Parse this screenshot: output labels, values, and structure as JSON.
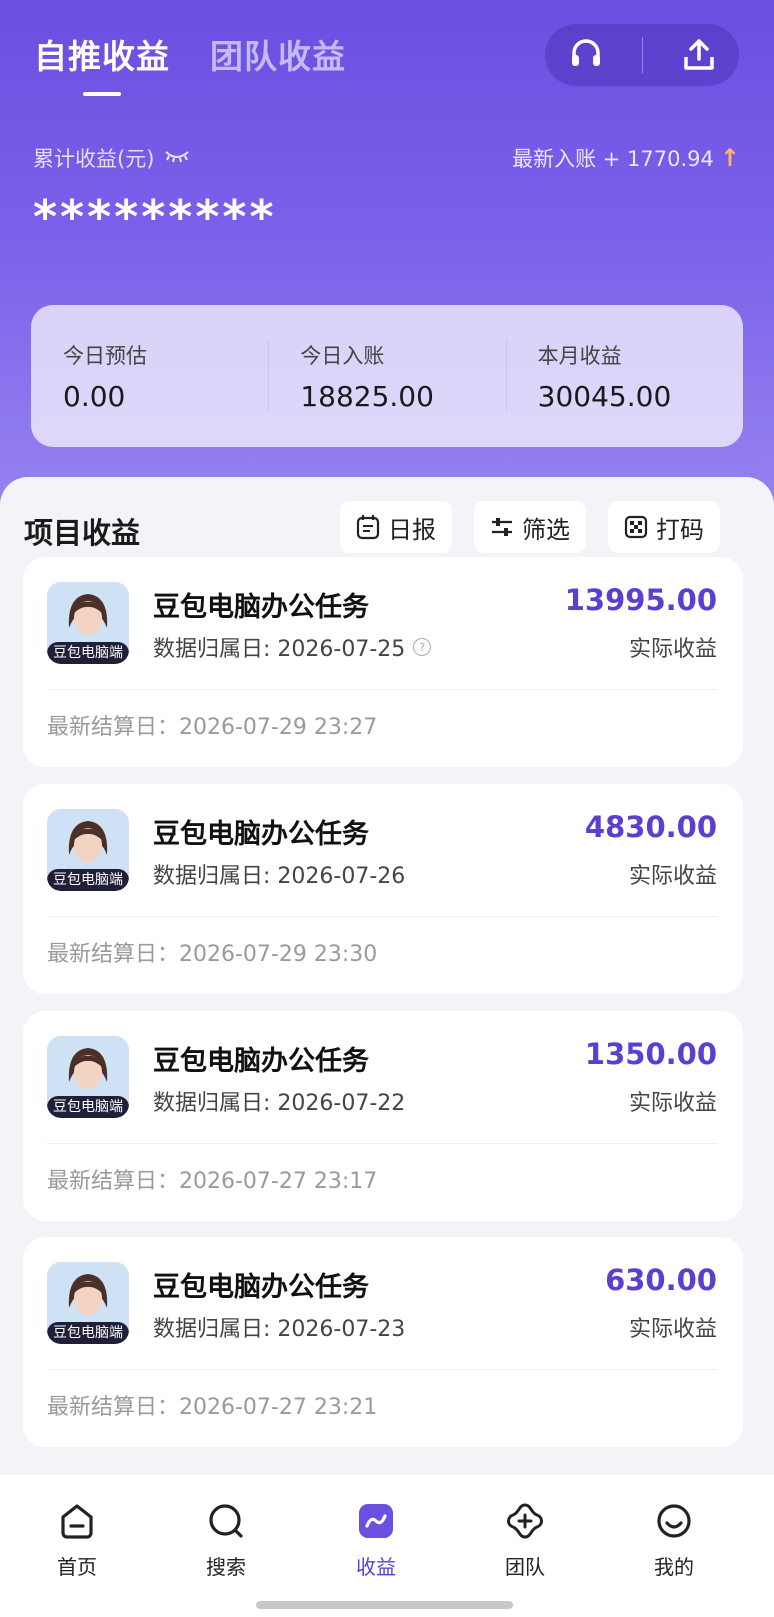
{
  "header": {
    "tabs": [
      {
        "label": "自推收益",
        "active": true
      },
      {
        "label": "团队收益",
        "active": false
      }
    ],
    "icons": {
      "support": "headset-icon",
      "share": "share-icon"
    }
  },
  "summary": {
    "cumulative_label": "累计收益(元)",
    "masked_value": "*********",
    "latest_label": "最新入账 + 1770.94",
    "latest_trend": "↑"
  },
  "stats": [
    {
      "label": "今日预估",
      "value": "0.00"
    },
    {
      "label": "今日入账",
      "value": "18825.00"
    },
    {
      "label": "本月收益",
      "value": "30045.00"
    }
  ],
  "project_section": {
    "title": "项目收益",
    "buttons": {
      "daily": "日报",
      "filter": "筛选",
      "code": "打码"
    }
  },
  "cards": [
    {
      "name": "豆包电脑办公任务",
      "date": "数据归属日: 2026-07-25",
      "amount": "13995.00",
      "amount_label": "实际收益",
      "settle": "最新结算日：2026-07-29 23:27",
      "avatar_tag": "豆包电脑端",
      "help": "?"
    },
    {
      "name": "豆包电脑办公任务",
      "date": "数据归属日: 2026-07-26",
      "amount": "4830.00",
      "amount_label": "实际收益",
      "settle": "最新结算日：2026-07-29 23:30",
      "avatar_tag": "豆包电脑端"
    },
    {
      "name": "豆包电脑办公任务",
      "date": "数据归属日: 2026-07-22",
      "amount": "1350.00",
      "amount_label": "实际收益",
      "settle": "最新结算日：2026-07-27 23:17",
      "avatar_tag": "豆包电脑端"
    },
    {
      "name": "豆包电脑办公任务",
      "date": "数据归属日: 2026-07-23",
      "amount": "630.00",
      "amount_label": "实际收益",
      "settle": "最新结算日：2026-07-27 23:21",
      "avatar_tag": "豆包电脑端"
    }
  ],
  "nav": [
    {
      "label": "首页",
      "icon": "home-icon"
    },
    {
      "label": "搜索",
      "icon": "search-icon"
    },
    {
      "label": "收益",
      "icon": "earnings-icon",
      "active": true
    },
    {
      "label": "团队",
      "icon": "team-icon"
    },
    {
      "label": "我的",
      "icon": "profile-icon"
    }
  ],
  "colors": {
    "accent": "#5a3fd0",
    "hero_top": "#6a4fe0",
    "hero_bottom": "#9a86f0"
  }
}
